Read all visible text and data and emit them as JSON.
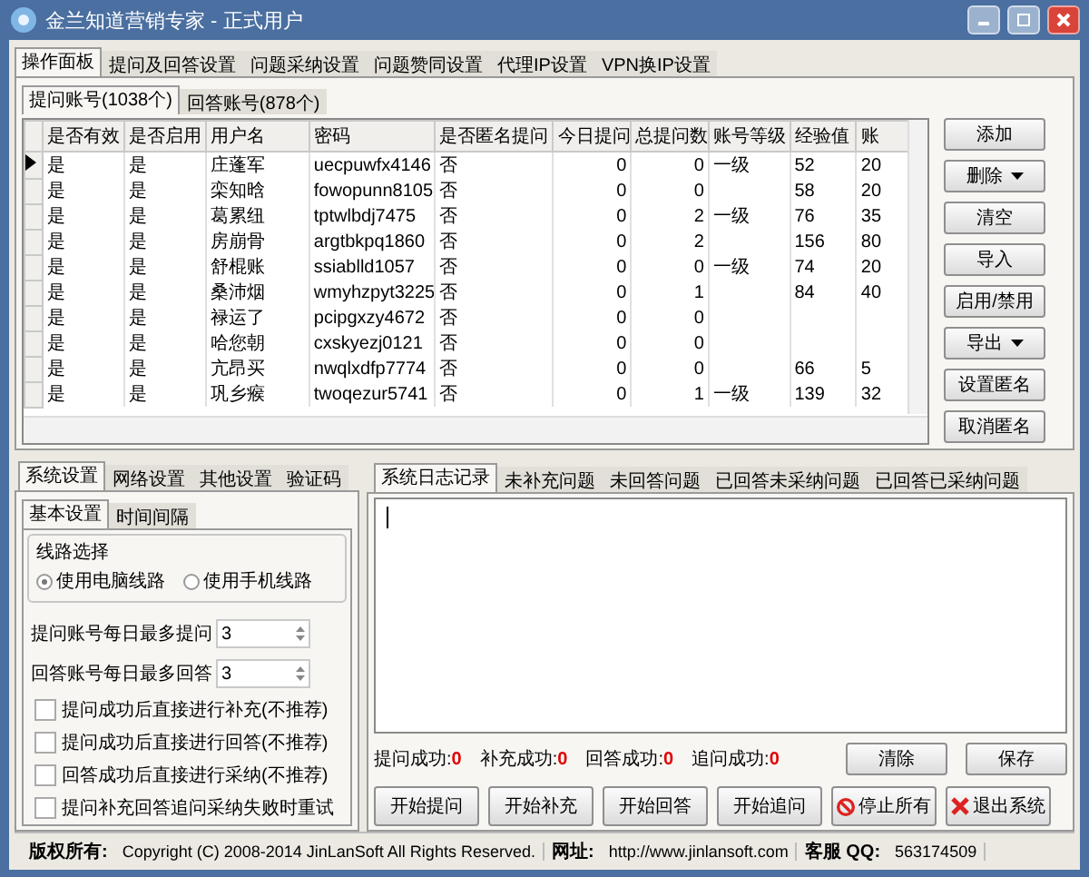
{
  "window": {
    "title": "金兰知道营销专家 - 正式用户"
  },
  "menu_tabs": [
    {
      "label": "操作面板",
      "selected": true
    },
    {
      "label": "提问及回答设置",
      "selected": false
    },
    {
      "label": "问题采纳设置",
      "selected": false
    },
    {
      "label": "问题赞同设置",
      "selected": false
    },
    {
      "label": "代理IP设置",
      "selected": false
    },
    {
      "label": "VPN换IP设置",
      "selected": false
    }
  ],
  "account_tabs": [
    {
      "label": "提问账号(1038个)",
      "selected": true
    },
    {
      "label": "回答账号(878个)",
      "selected": false
    }
  ],
  "table": {
    "columns": [
      "是否有效",
      "是否启用",
      "用户名",
      "密码",
      "是否匿名提问",
      "今日提问",
      "总提问数",
      "账号等级",
      "经验值",
      "账"
    ],
    "rows": [
      {
        "current": true,
        "cells": [
          "是",
          "是",
          "庄蓬军",
          "uecpuwfx4146",
          "否",
          "0",
          "0",
          "一级",
          "52",
          "20"
        ]
      },
      {
        "current": false,
        "cells": [
          "是",
          "是",
          "栾知晗",
          "fowopunn8105",
          "否",
          "0",
          "0",
          "",
          "58",
          "20"
        ]
      },
      {
        "current": false,
        "cells": [
          "是",
          "是",
          "葛累纽",
          "tptwlbdj7475",
          "否",
          "0",
          "2",
          "一级",
          "76",
          "35"
        ]
      },
      {
        "current": false,
        "cells": [
          "是",
          "是",
          "房崩骨",
          "argtbkpq1860",
          "否",
          "0",
          "2",
          "",
          "156",
          "80"
        ]
      },
      {
        "current": false,
        "cells": [
          "是",
          "是",
          "舒棍账",
          "ssiablld1057",
          "否",
          "0",
          "0",
          "一级",
          "74",
          "20"
        ]
      },
      {
        "current": false,
        "cells": [
          "是",
          "是",
          "桑沛烟",
          "wmyhzpyt3225",
          "否",
          "0",
          "1",
          "",
          "84",
          "40"
        ]
      },
      {
        "current": false,
        "cells": [
          "是",
          "是",
          "禄运了",
          "pcipgxzy4672",
          "否",
          "0",
          "0",
          "",
          "",
          ""
        ]
      },
      {
        "current": false,
        "cells": [
          "是",
          "是",
          "哈您朝",
          "cxskyezj0121",
          "否",
          "0",
          "0",
          "",
          "",
          ""
        ]
      },
      {
        "current": false,
        "cells": [
          "是",
          "是",
          "亢昂买",
          "nwqlxdfp7774",
          "否",
          "0",
          "0",
          "",
          "66",
          "5"
        ]
      },
      {
        "current": false,
        "cells": [
          "是",
          "是",
          "巩乡瘊",
          "twoqezur5741",
          "否",
          "0",
          "1",
          "一级",
          "139",
          "32"
        ]
      }
    ]
  },
  "side_buttons": [
    {
      "label": "添加",
      "dropdown": false
    },
    {
      "label": "删除",
      "dropdown": true
    },
    {
      "label": "清空",
      "dropdown": false
    },
    {
      "label": "导入",
      "dropdown": false
    },
    {
      "label": "启用/禁用",
      "dropdown": false
    },
    {
      "label": "导出",
      "dropdown": true
    },
    {
      "label": "设置匿名",
      "dropdown": false
    },
    {
      "label": "取消匿名",
      "dropdown": false
    }
  ],
  "settings_tabs": [
    {
      "label": "系统设置",
      "selected": true
    },
    {
      "label": "网络设置",
      "selected": false
    },
    {
      "label": "其他设置",
      "selected": false
    },
    {
      "label": "验证码",
      "selected": false
    }
  ],
  "sub_tabs": [
    {
      "label": "基本设置",
      "selected": true
    },
    {
      "label": "时间间隔",
      "selected": false
    }
  ],
  "route_group": {
    "title": "线路选择",
    "options": [
      {
        "label": "使用电脑线路",
        "selected": true
      },
      {
        "label": "使用手机线路",
        "selected": false
      }
    ]
  },
  "spin_fields": [
    {
      "label": "提问账号每日最多提问",
      "value": "3"
    },
    {
      "label": "回答账号每日最多回答",
      "value": "3"
    }
  ],
  "checkboxes": [
    {
      "label": "提问成功后直接进行补充(不推荐)",
      "checked": false
    },
    {
      "label": "提问成功后直接进行回答(不推荐)",
      "checked": false
    },
    {
      "label": "回答成功后直接进行采纳(不推荐)",
      "checked": false
    },
    {
      "label": "提问补充回答追问采纳失败时重试",
      "checked": false
    }
  ],
  "log_tabs": [
    {
      "label": "系统日志记录",
      "selected": true
    },
    {
      "label": "未补充问题",
      "selected": false
    },
    {
      "label": "未回答问题",
      "selected": false
    },
    {
      "label": "已回答未采纳问题",
      "selected": false
    },
    {
      "label": "已回答已采纳问题",
      "selected": false
    }
  ],
  "counters": [
    {
      "label": "提问成功:",
      "value": "0"
    },
    {
      "label": "补充成功:",
      "value": "0"
    },
    {
      "label": "回答成功:",
      "value": "0"
    },
    {
      "label": "追问成功:",
      "value": "0"
    }
  ],
  "log_buttons": [
    "清除",
    "保存"
  ],
  "action_buttons": [
    {
      "label": "开始提问",
      "kind": "plain"
    },
    {
      "label": "开始补充",
      "kind": "plain"
    },
    {
      "label": "开始回答",
      "kind": "plain"
    },
    {
      "label": "开始追问",
      "kind": "plain"
    },
    {
      "label": "停止所有",
      "kind": "stop"
    },
    {
      "label": "退出系统",
      "kind": "exit"
    }
  ],
  "status_bar": [
    {
      "label": "版权所有:",
      "value": "Copyright (C) 2008-2014 JinLanSoft All Rights Reserved."
    },
    {
      "label": "网址:",
      "value": "http://www.jinlansoft.com"
    },
    {
      "label": "客服 QQ:",
      "value": "563174509"
    }
  ]
}
